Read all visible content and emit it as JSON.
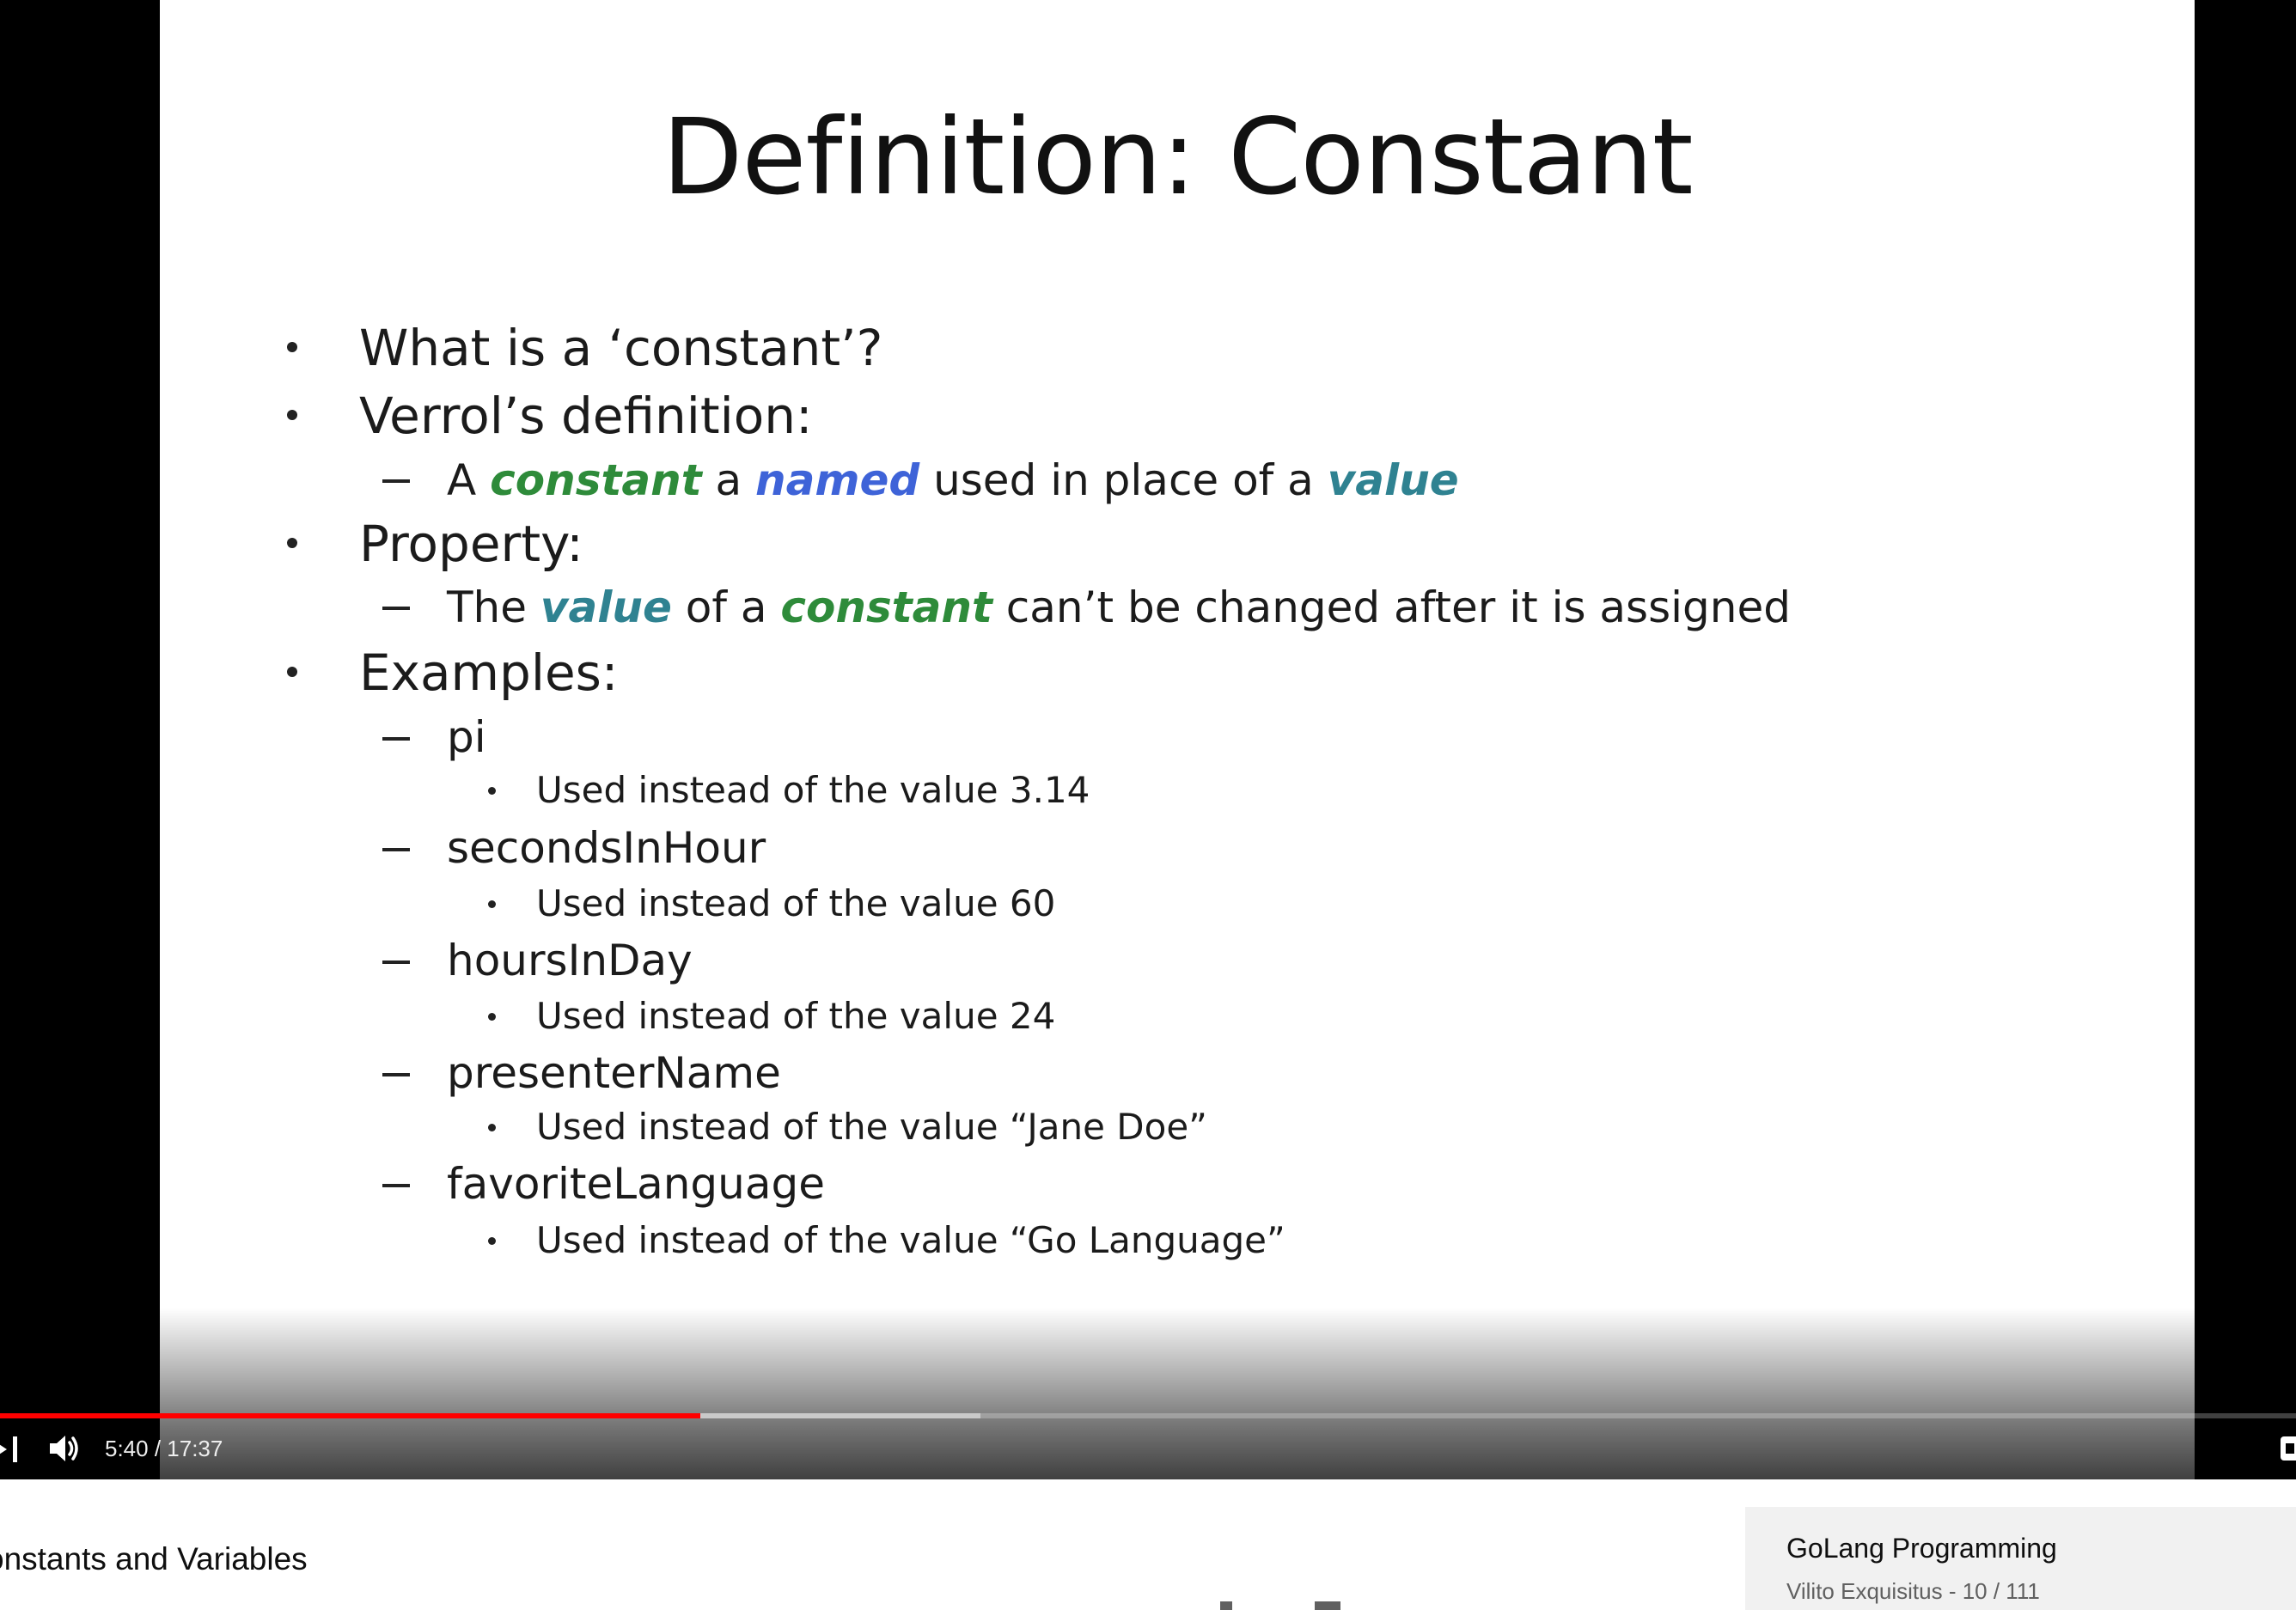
{
  "video": {
    "slide": {
      "title": "Definition: Constant",
      "items": {
        "q1": "What is a ‘constant’?",
        "q2": "Verrol’s definition:",
        "def": {
          "p1": "A ",
          "w1": "constant",
          "p2": " a ",
          "w2": "named",
          "p3": " used in place of a ",
          "w3": "value"
        },
        "q3": "Property:",
        "prop": {
          "p1": "The ",
          "w1": "value",
          "p2": " of a ",
          "w2": "constant",
          "p3": " can’t be changed after it is assigned"
        },
        "q4": "Examples:",
        "examples": [
          {
            "name": "pi",
            "desc": "Used instead of the value 3.14"
          },
          {
            "name": "secondsInHour",
            "desc": "Used instead of the value 60"
          },
          {
            "name": "hoursInDay",
            "desc": "Used instead of the value 24"
          },
          {
            "name": "presenterName",
            "desc": "Used instead of the value “Jane Doe”"
          },
          {
            "name": "favoriteLanguage",
            "desc": "Used instead of the value “Go Language”"
          }
        ]
      }
    },
    "controls": {
      "time": "5:40 / 17:37",
      "played_fraction": 0.305,
      "buffered_fraction": 0.427,
      "accent": "#ff0000"
    }
  },
  "below": {
    "video_title": "onstants and Variables"
  },
  "playlist": {
    "title": "GoLang Programming",
    "subtitle": "Vilito Exquisitus - 10 / 111"
  },
  "icons": {
    "next": "skip-next-icon",
    "volume": "volume-icon",
    "cc": "subtitles-icon"
  }
}
